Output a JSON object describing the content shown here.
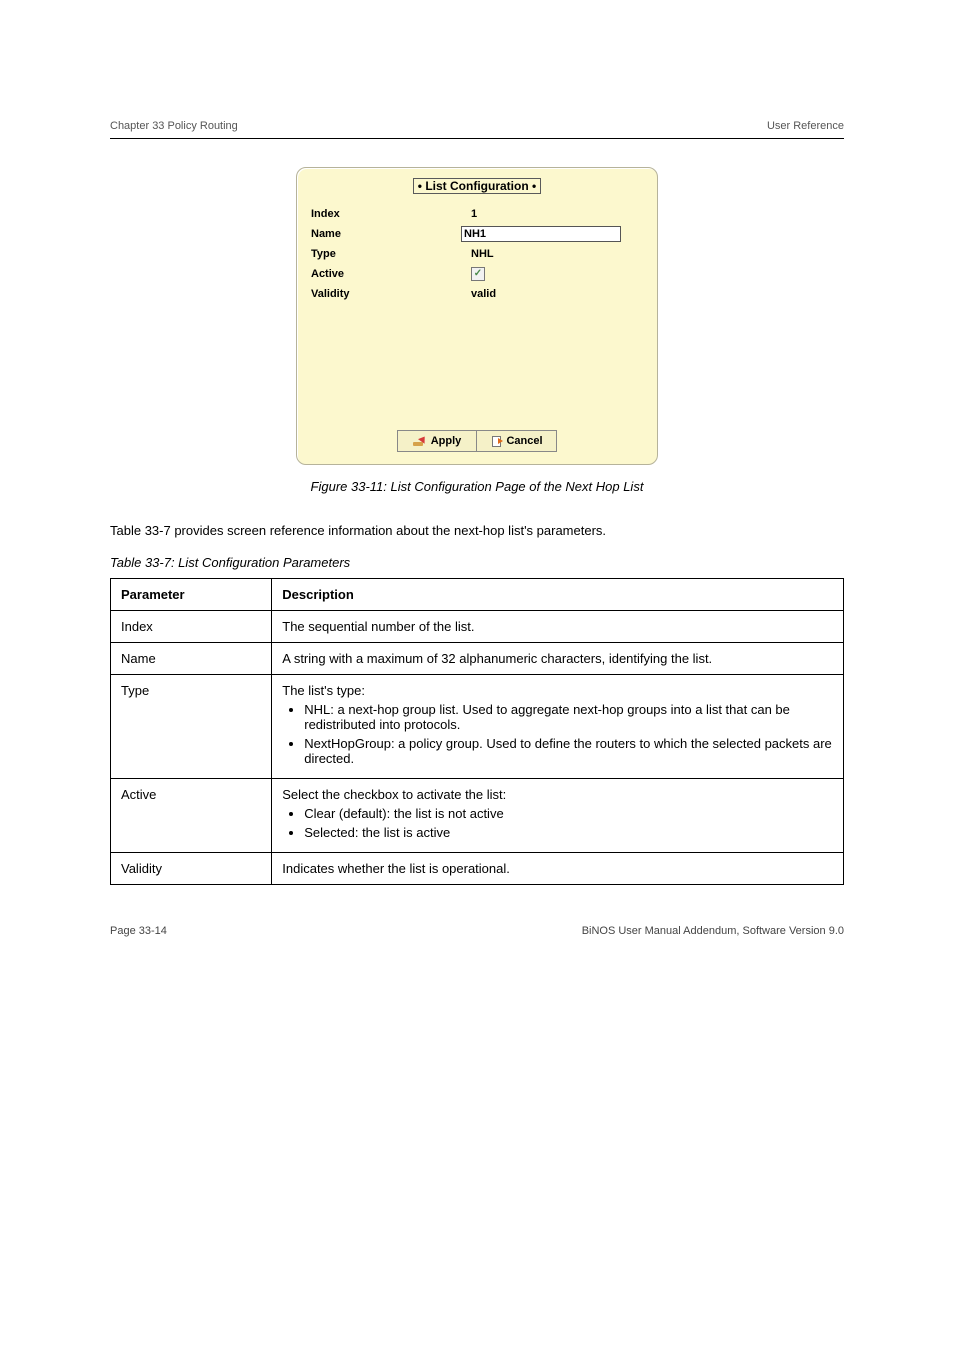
{
  "header": {
    "left": "Chapter 33 Policy Routing",
    "right": "User Reference"
  },
  "dialog": {
    "title": "List Configuration",
    "rows": {
      "index_label": "Index",
      "index_value": "1",
      "name_label": "Name",
      "name_value": "NH1",
      "type_label": "Type",
      "type_value": "NHL",
      "active_label": "Active",
      "active_checked": "✓",
      "validity_label": "Validity",
      "validity_value": "valid"
    },
    "buttons": {
      "apply": "Apply",
      "cancel": "Cancel"
    }
  },
  "figure_caption": "Figure 33-11: List Configuration Page of the Next Hop List",
  "paragraph": "Table 33-7 provides screen reference information about the next-hop list's parameters.",
  "table_caption": "Table 33-7: List Configuration Parameters",
  "table": {
    "head": {
      "param": "Parameter",
      "desc": "Description"
    },
    "rows": [
      {
        "param": "Index",
        "desc": "The sequential number of the list."
      },
      {
        "param": "Name",
        "desc": "A string with a maximum of 32 alphanumeric characters, identifying the list."
      },
      {
        "param": "Type",
        "desc_lead": "The list's type:",
        "items": [
          "NHL: a next-hop group list. Used to aggregate next-hop groups into a list that can be redistributed into protocols.",
          "NextHopGroup: a policy group. Used to define the routers to which the selected packets are directed."
        ]
      },
      {
        "param": "Active",
        "desc_lead": "Select the checkbox to activate the list:",
        "items": [
          "Clear (default): the list is not active",
          "Selected: the list is active"
        ]
      },
      {
        "param": "Validity",
        "desc": "Indicates whether the list is operational."
      }
    ]
  },
  "footer": {
    "left": "Page 33-14",
    "right": "BiNOS User Manual Addendum, Software Version 9.0"
  }
}
